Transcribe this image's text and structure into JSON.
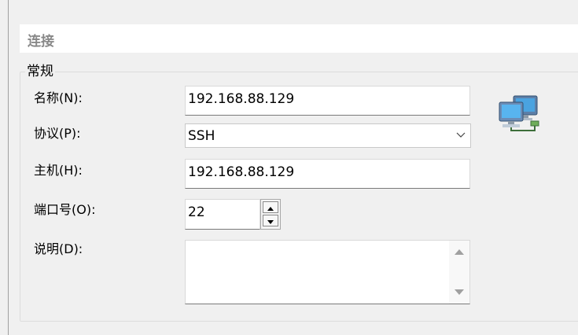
{
  "section": {
    "title": "连接"
  },
  "group": {
    "title": "常规"
  },
  "fields": {
    "name_label": "名称(N):",
    "name_value": "192.168.88.129",
    "protocol_label": "协议(P):",
    "protocol_value": "SSH",
    "host_label": "主机(H):",
    "host_value": "192.168.88.129",
    "port_label": "端口号(O):",
    "port_value": "22",
    "description_label": "说明(D):",
    "description_value": ""
  },
  "icons": {
    "network": "network-computers-icon"
  }
}
